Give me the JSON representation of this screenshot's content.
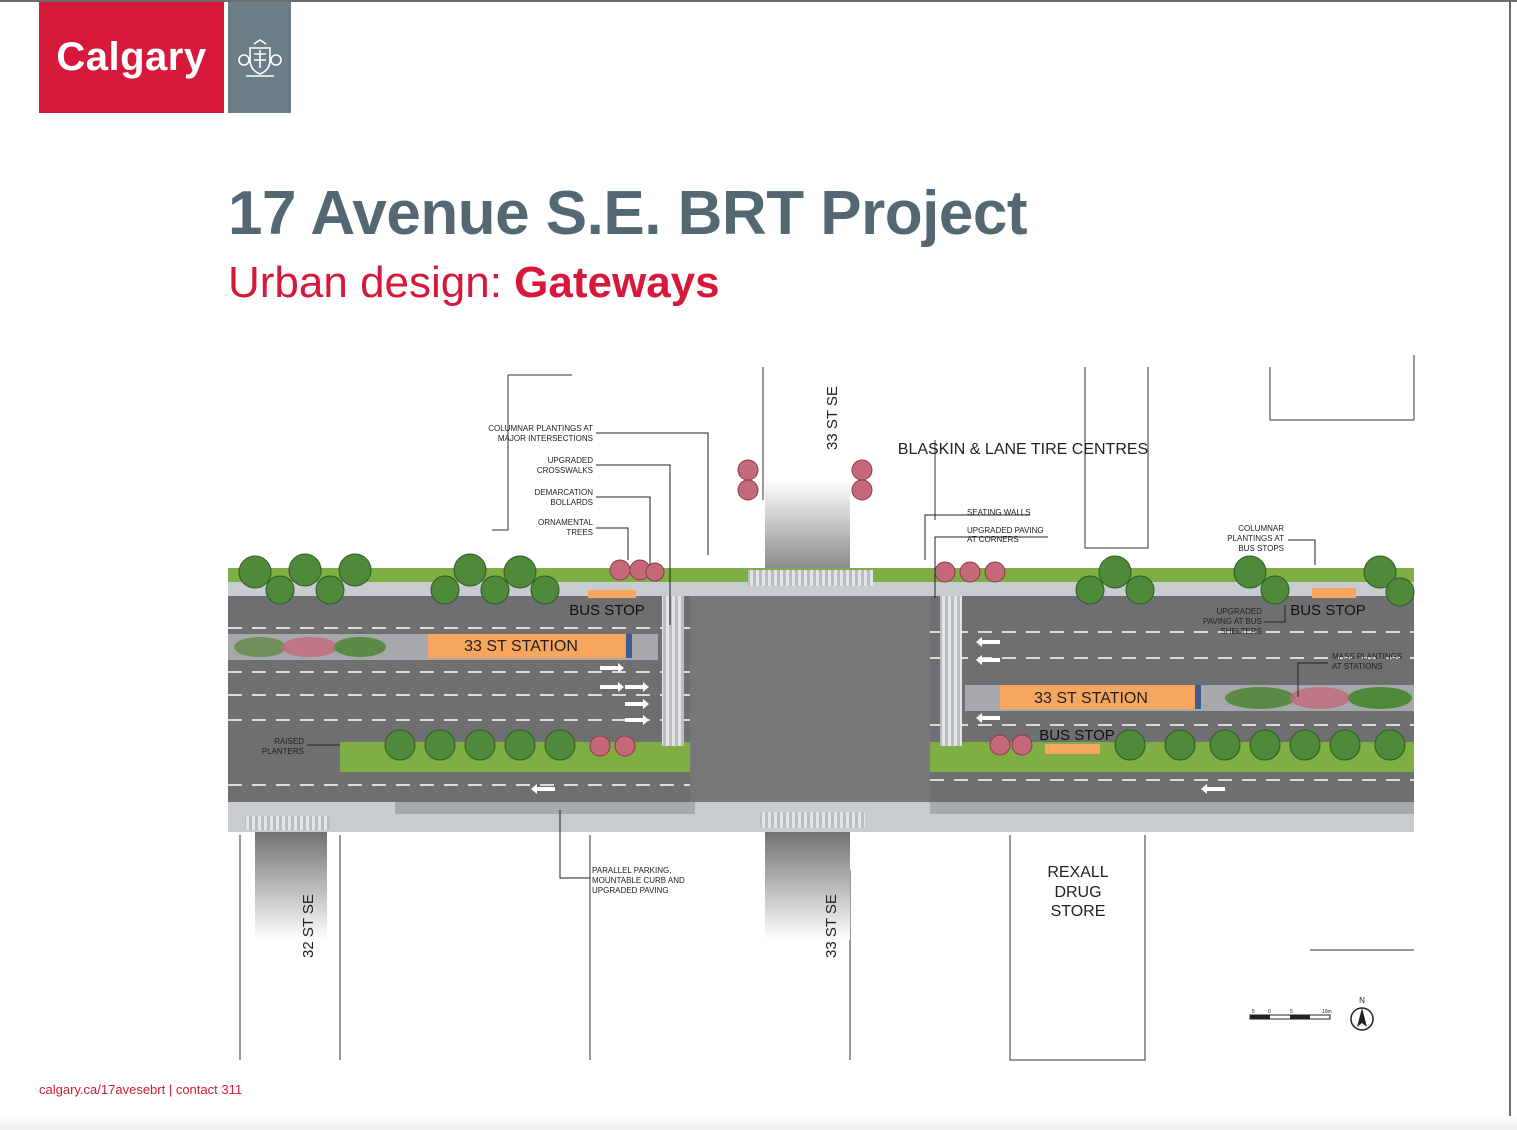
{
  "brand": {
    "name": "Calgary",
    "red": "#d6193a",
    "slate": "#546873",
    "crest_icon": "city-crest-icon"
  },
  "title": "17 Avenue S.E. BRT Project",
  "subtitle": {
    "prefix": "Urban design: ",
    "highlight": "Gateways"
  },
  "footer": "calgary.ca/17avesebrt | contact 311",
  "plan": {
    "streets": {
      "north_33": "33 ST SE",
      "south_33": "33 ST SE",
      "south_32": "32 ST SE"
    },
    "buildings": {
      "blaskin": "BLASKIN & LANE TIRE CENTRES",
      "rexall_1": "REXALL",
      "rexall_2": "DRUG",
      "rexall_3": "STORE"
    },
    "stations": {
      "west": "33 ST STATION",
      "east": "33 ST STATION"
    },
    "bus_stops": {
      "nw": "BUS STOP",
      "ne": "BUS STOP",
      "se": "BUS STOP"
    },
    "callouts": {
      "columnar_major_1": "COLUMNAR PLANTINGS AT",
      "columnar_major_2": "MAJOR INTERSECTIONS",
      "crosswalks_1": "UPGRADED",
      "crosswalks_2": "CROSSWALKS",
      "bollards_1": "DEMARCATION",
      "bollards_2": "BOLLARDS",
      "trees_1": "ORNAMENTAL",
      "trees_2": "TREES",
      "seating": "SEATING WALLS",
      "paving_corners_1": "UPGRADED PAVING",
      "paving_corners_2": "AT CORNERS",
      "columnar_bus_1": "COLUMNAR",
      "columnar_bus_2": "PLANTINGS AT",
      "columnar_bus_3": "BUS STOPS",
      "paving_shelters_1": "UPGRADED",
      "paving_shelters_2": "PAVING AT BUS",
      "paving_shelters_3": "SHELTERS",
      "mass_1": "MASS PLANTINGS",
      "mass_2": "AT STATIONS",
      "planters_1": "RAISED",
      "planters_2": "PLANTERS",
      "parking_1": "PARALLEL PARKING,",
      "parking_2": "MOUNTABLE CURB AND",
      "parking_3": "UPGRADED PAVING"
    },
    "scale_bar": {
      "labels": [
        "5",
        "0",
        "5",
        "10m"
      ]
    },
    "north_arrow": "N",
    "colors": {
      "road": "#6f6f71",
      "sidewalk": "#c8cbcf",
      "grass": "#7fae45",
      "tree": "#4f8a3a",
      "station": "#f6a65f",
      "red_tree": "#c5697a"
    }
  }
}
